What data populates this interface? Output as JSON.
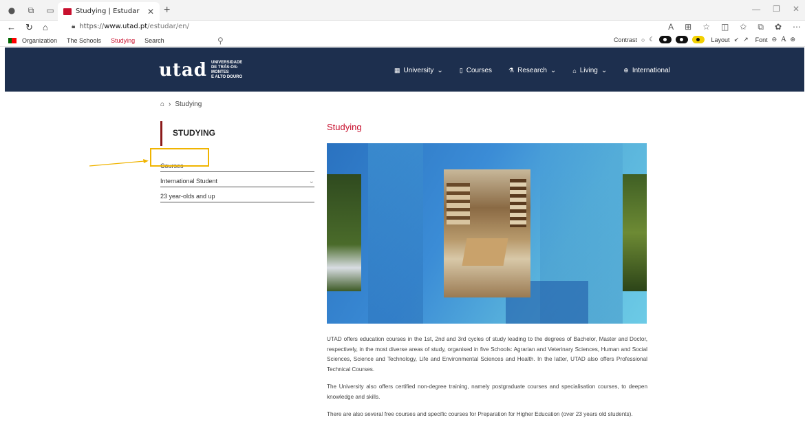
{
  "browser": {
    "tab_title": "Studying | Estudar",
    "url_prefix": "https://",
    "url_host": "www.utad.pt",
    "url_path": "/estudar/en/"
  },
  "utility_bar": {
    "links": [
      "Organization",
      "The Schools",
      "Studying",
      "Search"
    ],
    "active": "Studying",
    "contrast_label": "Contrast",
    "layout_label": "Layout",
    "font_label": "Font",
    "font_letter": "A"
  },
  "header": {
    "logo_text": "utad",
    "logo_sub1": "UNIVERSIDADE",
    "logo_sub2": "DE TRÁS-OS-MONTES",
    "logo_sub3": "E ALTO DOURO",
    "nav": [
      {
        "label": "University",
        "icon": "building-icon",
        "has_dropdown": true
      },
      {
        "label": "Courses",
        "icon": "book-icon",
        "has_dropdown": false
      },
      {
        "label": "Research",
        "icon": "flask-icon",
        "has_dropdown": true
      },
      {
        "label": "Living",
        "icon": "house-icon",
        "has_dropdown": true
      },
      {
        "label": "International",
        "icon": "globe-icon",
        "has_dropdown": false
      }
    ]
  },
  "breadcrumb": {
    "current": "Studying"
  },
  "sidebar": {
    "title": "STUDYING",
    "items": [
      {
        "label": "Courses"
      },
      {
        "label": "International Student"
      },
      {
        "label": "23 year-olds and up"
      }
    ]
  },
  "content": {
    "title": "Studying",
    "paragraphs": [
      "UTAD offers education courses in the 1st, 2nd and 3rd cycles of study leading to the degrees of Bachelor, Master and Doctor, respectively, in the most diverse areas of study, organised in five Schools: Agrarian and Veterinary Sciences, Human and Social Sciences, Science and Technology, Life and Environmental Sciences and Health. In the latter, UTAD also offers Professional Technical Courses.",
      "The University also offers certified non-degree training, namely postgraduate courses and specialisation courses, to deepen knowledge and skills.",
      "There are also several free courses and specific courses for Preparation for Higher Education (over 23 years old students)."
    ]
  },
  "colors": {
    "header_bg": "#1d2f4e",
    "accent_red": "#c8102e",
    "highlight": "#f0b400"
  }
}
